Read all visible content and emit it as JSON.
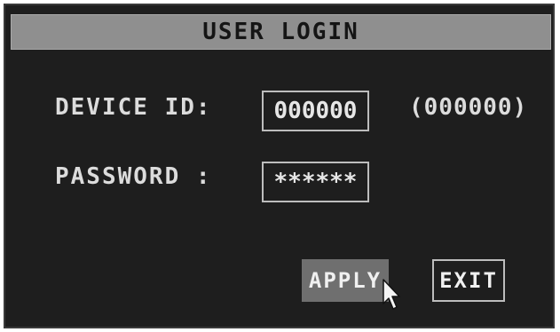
{
  "dialog": {
    "title": "USER LOGIN"
  },
  "device_id": {
    "label": "DEVICE ID:",
    "value": "000000",
    "hint": "(000000)"
  },
  "password": {
    "label": "PASSWORD :",
    "value": "******"
  },
  "buttons": {
    "apply_label": "APPLY",
    "exit_label": "EXIT"
  },
  "cursor": {
    "icon": "mouse-pointer-icon"
  },
  "colors": {
    "title_bar": "#8f8f8f",
    "background": "#1e1e1e",
    "apply_highlight": "#6f6f6f",
    "text": "#dcdcdc"
  }
}
